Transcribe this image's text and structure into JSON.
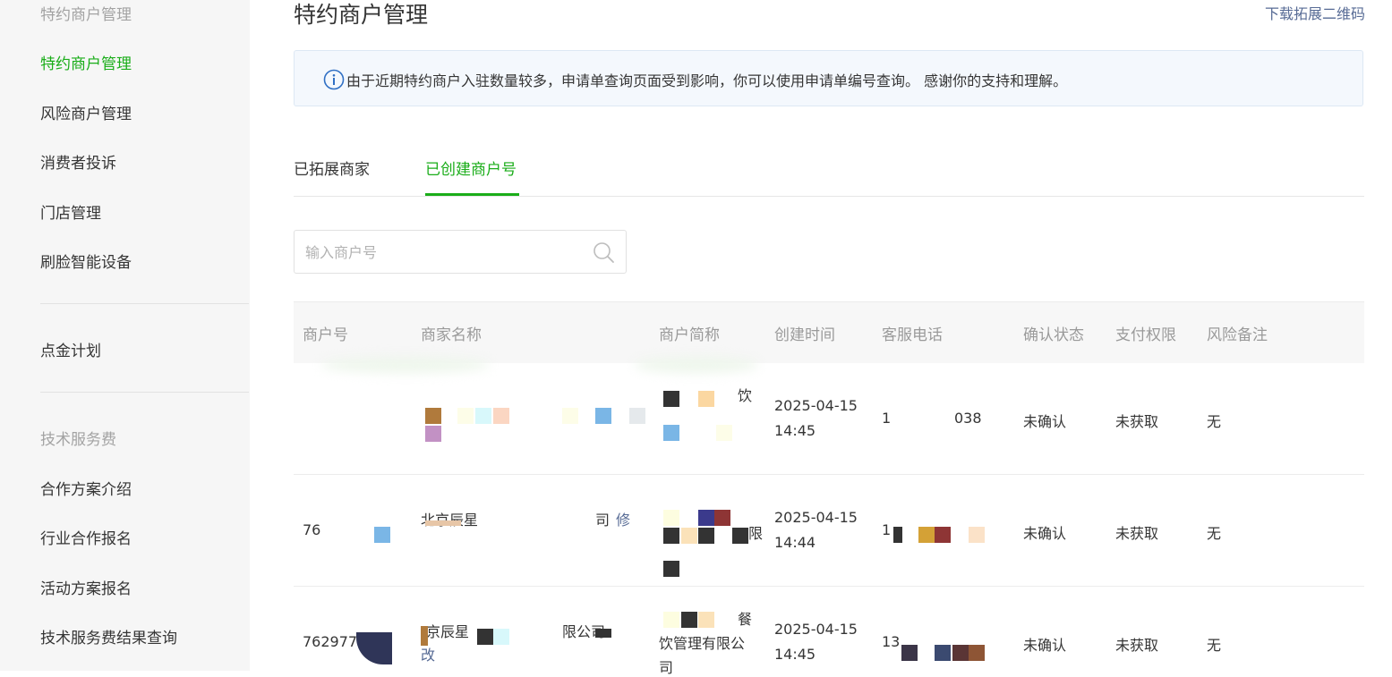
{
  "sidebar": {
    "group1_title": "特约商户管理",
    "items1": [
      {
        "label": "特约商户管理"
      },
      {
        "label": "风险商户管理"
      },
      {
        "label": "消费者投诉"
      },
      {
        "label": "门店管理"
      },
      {
        "label": "刷脸智能设备"
      }
    ],
    "item_gold": "点金计划",
    "group2_title": "技术服务费",
    "items2": [
      {
        "label": "合作方案介绍"
      },
      {
        "label": "行业合作报名"
      },
      {
        "label": "活动方案报名"
      },
      {
        "label": "技术服务费结果查询"
      }
    ]
  },
  "page": {
    "title": "特约商户管理",
    "download_link": "下载拓展二维码"
  },
  "notice": {
    "text": "由于近期特约商户入驻数量较多，申请单查询页面受到影响，你可以使用申请单编号查询。 感谢你的支持和理解。"
  },
  "tabs": [
    {
      "label": "已拓展商家"
    },
    {
      "label": "已创建商户号"
    }
  ],
  "search": {
    "placeholder": "输入商户号"
  },
  "table": {
    "headers": [
      "商户号",
      "商家名称",
      "商户简称",
      "创建时间",
      "客服电话",
      "确认状态",
      "支付权限",
      "风险备注"
    ],
    "rows": [
      {
        "merchant_id": "",
        "merchant_name": "",
        "short_name_tail": "饮",
        "created_date": "2025-04-15",
        "created_time": "14:45",
        "phone_head": "1",
        "phone_tail": "038",
        "status": "未确认",
        "permission": "未获取",
        "risk": "无"
      },
      {
        "merchant_id": "76",
        "merchant_name": "北京辰星",
        "merchant_name_tail": "司",
        "edit_link": "修",
        "short_name_tail": "限",
        "created_date": "2025-04-15",
        "created_time": "14:44",
        "phone_head": "1",
        "status": "未确认",
        "permission": "未获取",
        "risk": "无"
      },
      {
        "merchant_id": "762977",
        "merchant_name": "京辰星",
        "merchant_name_mid": "限公司",
        "edit_link": "改",
        "short_name_line1": "餐",
        "short_name_line2": "饮管理有限公",
        "short_name_line3": "司",
        "created_date": "2025-04-15",
        "created_time": "14:45",
        "phone_head": "13",
        "status": "未确认",
        "permission": "未获取",
        "risk": "无"
      }
    ]
  },
  "colors": {
    "accent": "#1aad19",
    "link": "#576b95",
    "sidebar_bg": "#f6f6f6"
  }
}
